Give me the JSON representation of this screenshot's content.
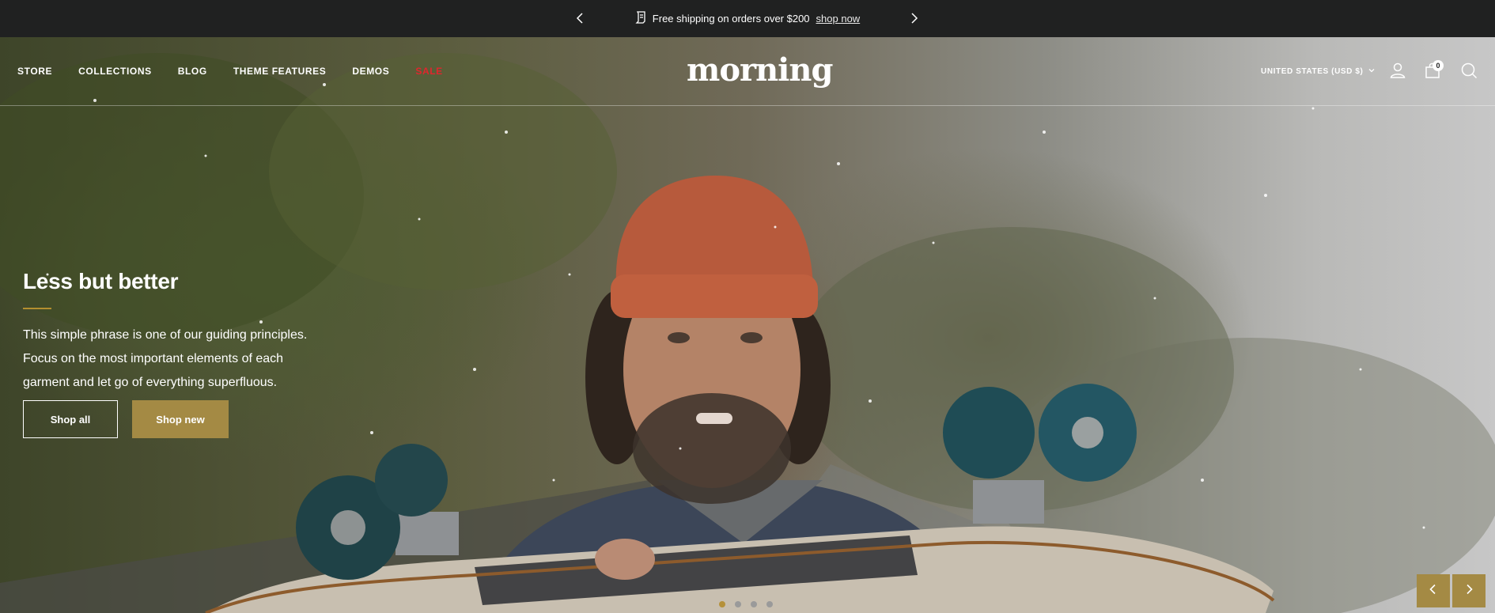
{
  "announcement": {
    "text": "Free shipping on orders over $200",
    "link": "shop now"
  },
  "header": {
    "nav": [
      "STORE",
      "COLLECTIONS",
      "BLOG",
      "THEME FEATURES",
      "DEMOS",
      "SALE"
    ],
    "logo": "morning",
    "currency": "UNITED STATES (USD $)",
    "cart_count": "0"
  },
  "hero": {
    "title": "Less but better",
    "description": [
      "This simple phrase is one of our guiding principles.",
      "Focus on the most important elements of each",
      "garment and let go of everything superfluous."
    ],
    "buttons": {
      "shop_all": "Shop all",
      "shop_new": "Shop new"
    },
    "slides": 4,
    "active_slide": 1
  },
  "colors": {
    "accent": "#a48a44",
    "sale": "#e0262d",
    "announcement_bg": "#202121"
  },
  "icons": [
    "chevron-left-icon",
    "chevron-right-icon",
    "receipt-icon",
    "chevron-down-icon",
    "user-icon",
    "cart-icon",
    "search-icon"
  ]
}
